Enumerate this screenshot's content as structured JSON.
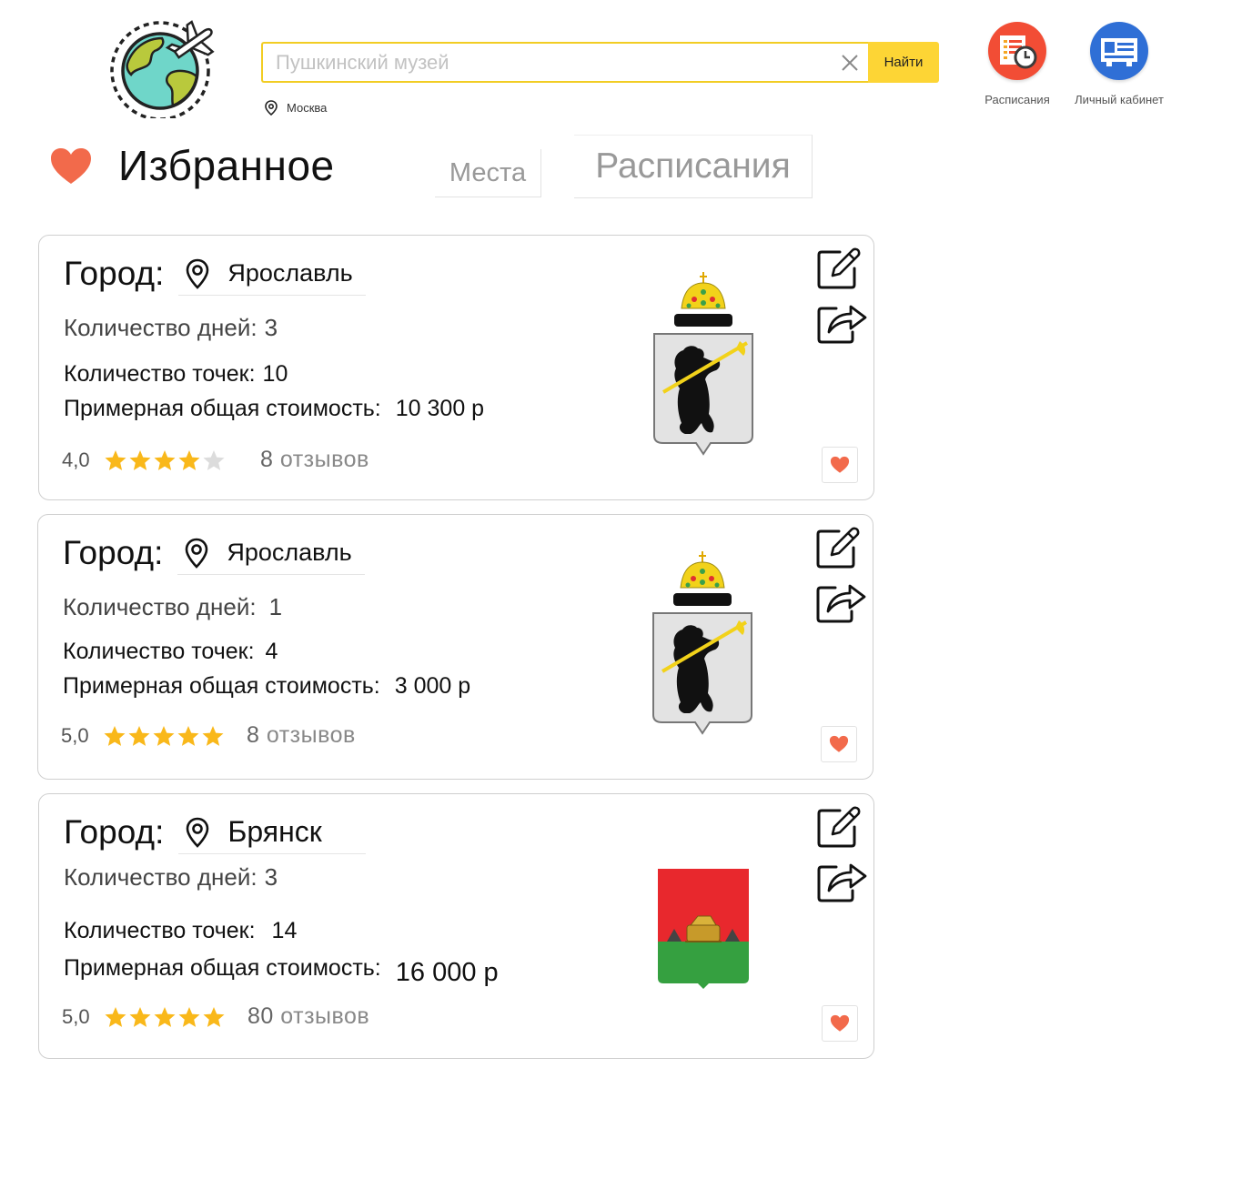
{
  "search": {
    "placeholder": "Пушкинский музей",
    "button_label": "Найти",
    "location": "Москва"
  },
  "nav": {
    "schedules_label": "Расписания",
    "cabinet_label": "Личный кабинет"
  },
  "page": {
    "title": "Избранное",
    "tab_places": "Места",
    "tab_schedules": "Расписания"
  },
  "colors": {
    "accent_yellow": "#fdd535",
    "heart": "#f26a4b",
    "star": "#f9b81a",
    "schedules_icon_bg": "#f24d35",
    "cabinet_icon_bg": "#2f6fd6"
  },
  "cards": [
    {
      "city_label": "Город:",
      "city": "Ярославль",
      "days_label": "Количество дней:",
      "days": "3",
      "points_label": "Количество точек:",
      "points": "10",
      "cost_label": "Примерная общая стоимость:",
      "cost": "10 300 р",
      "rating": "4,0",
      "stars": 4,
      "reviews_count": "8",
      "reviews_word": "отзывов",
      "coat": "yaroslavl-coat-of-arms"
    },
    {
      "city_label": "Город:",
      "city": "Ярославль",
      "days_label": "Количество дней:",
      "days": "1",
      "points_label": "Количество точек:",
      "points": "4",
      "cost_label": "Примерная общая стоимость:",
      "cost": "3 000 р",
      "rating": "5,0",
      "stars": 5,
      "reviews_count": "8",
      "reviews_word": "отзывов",
      "coat": "yaroslavl-coat-of-arms"
    },
    {
      "city_label": "Город:",
      "city": "Брянск",
      "days_label": "Количество дней:",
      "days": "3",
      "points_label": "Количество точек:",
      "points": "14",
      "cost_label": "Примерная общая стоимость:",
      "cost": "16 000 р",
      "rating": "5,0",
      "stars": 5,
      "reviews_count": "80",
      "reviews_word": "отзывов",
      "coat": "bryansk-coat-of-arms"
    }
  ]
}
